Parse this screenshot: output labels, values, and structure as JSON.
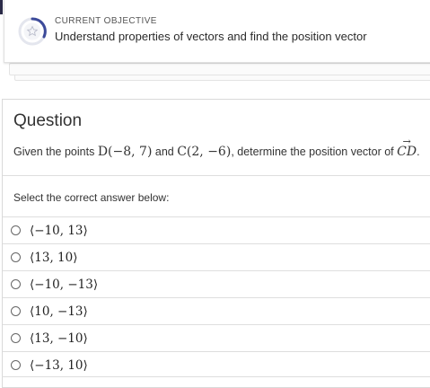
{
  "objective": {
    "kicker": "CURRENT OBJECTIVE",
    "title": "Understand properties of vectors and find the position vector",
    "icon": "star-progress-icon"
  },
  "question": {
    "heading": "Question",
    "prompt_prefix": "Given the points ",
    "point_d": "D(−8, 7)",
    "and_text": " and ",
    "point_c": "C(2, −6)",
    "prompt_mid": ", determine the position vector of ",
    "vector": "CD",
    "period": ".",
    "instruction": "Select the correct answer below:"
  },
  "options": [
    {
      "label": "⟨−10, 13⟩"
    },
    {
      "label": "⟨13, 10⟩"
    },
    {
      "label": "⟨−10, −13⟩"
    },
    {
      "label": "⟨10, −13⟩"
    },
    {
      "label": "⟨13, −10⟩"
    },
    {
      "label": "⟨−13, 10⟩"
    }
  ]
}
